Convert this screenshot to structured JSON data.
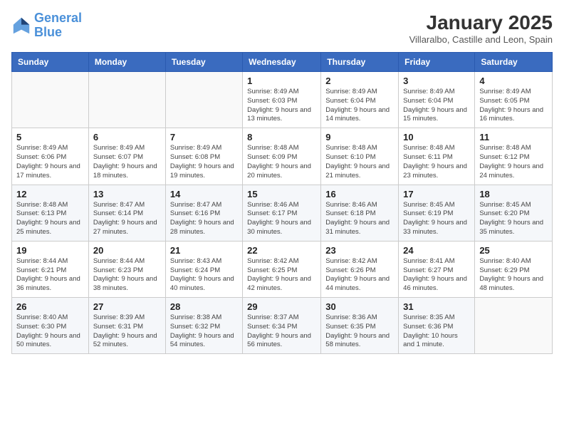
{
  "header": {
    "logo_line1": "General",
    "logo_line2": "Blue",
    "month": "January 2025",
    "location": "Villaralbo, Castille and Leon, Spain"
  },
  "weekdays": [
    "Sunday",
    "Monday",
    "Tuesday",
    "Wednesday",
    "Thursday",
    "Friday",
    "Saturday"
  ],
  "weeks": [
    [
      {
        "day": "",
        "detail": ""
      },
      {
        "day": "",
        "detail": ""
      },
      {
        "day": "",
        "detail": ""
      },
      {
        "day": "1",
        "detail": "Sunrise: 8:49 AM\nSunset: 6:03 PM\nDaylight: 9 hours and 13 minutes."
      },
      {
        "day": "2",
        "detail": "Sunrise: 8:49 AM\nSunset: 6:04 PM\nDaylight: 9 hours and 14 minutes."
      },
      {
        "day": "3",
        "detail": "Sunrise: 8:49 AM\nSunset: 6:04 PM\nDaylight: 9 hours and 15 minutes."
      },
      {
        "day": "4",
        "detail": "Sunrise: 8:49 AM\nSunset: 6:05 PM\nDaylight: 9 hours and 16 minutes."
      }
    ],
    [
      {
        "day": "5",
        "detail": "Sunrise: 8:49 AM\nSunset: 6:06 PM\nDaylight: 9 hours and 17 minutes."
      },
      {
        "day": "6",
        "detail": "Sunrise: 8:49 AM\nSunset: 6:07 PM\nDaylight: 9 hours and 18 minutes."
      },
      {
        "day": "7",
        "detail": "Sunrise: 8:49 AM\nSunset: 6:08 PM\nDaylight: 9 hours and 19 minutes."
      },
      {
        "day": "8",
        "detail": "Sunrise: 8:48 AM\nSunset: 6:09 PM\nDaylight: 9 hours and 20 minutes."
      },
      {
        "day": "9",
        "detail": "Sunrise: 8:48 AM\nSunset: 6:10 PM\nDaylight: 9 hours and 21 minutes."
      },
      {
        "day": "10",
        "detail": "Sunrise: 8:48 AM\nSunset: 6:11 PM\nDaylight: 9 hours and 23 minutes."
      },
      {
        "day": "11",
        "detail": "Sunrise: 8:48 AM\nSunset: 6:12 PM\nDaylight: 9 hours and 24 minutes."
      }
    ],
    [
      {
        "day": "12",
        "detail": "Sunrise: 8:48 AM\nSunset: 6:13 PM\nDaylight: 9 hours and 25 minutes."
      },
      {
        "day": "13",
        "detail": "Sunrise: 8:47 AM\nSunset: 6:14 PM\nDaylight: 9 hours and 27 minutes."
      },
      {
        "day": "14",
        "detail": "Sunrise: 8:47 AM\nSunset: 6:16 PM\nDaylight: 9 hours and 28 minutes."
      },
      {
        "day": "15",
        "detail": "Sunrise: 8:46 AM\nSunset: 6:17 PM\nDaylight: 9 hours and 30 minutes."
      },
      {
        "day": "16",
        "detail": "Sunrise: 8:46 AM\nSunset: 6:18 PM\nDaylight: 9 hours and 31 minutes."
      },
      {
        "day": "17",
        "detail": "Sunrise: 8:45 AM\nSunset: 6:19 PM\nDaylight: 9 hours and 33 minutes."
      },
      {
        "day": "18",
        "detail": "Sunrise: 8:45 AM\nSunset: 6:20 PM\nDaylight: 9 hours and 35 minutes."
      }
    ],
    [
      {
        "day": "19",
        "detail": "Sunrise: 8:44 AM\nSunset: 6:21 PM\nDaylight: 9 hours and 36 minutes."
      },
      {
        "day": "20",
        "detail": "Sunrise: 8:44 AM\nSunset: 6:23 PM\nDaylight: 9 hours and 38 minutes."
      },
      {
        "day": "21",
        "detail": "Sunrise: 8:43 AM\nSunset: 6:24 PM\nDaylight: 9 hours and 40 minutes."
      },
      {
        "day": "22",
        "detail": "Sunrise: 8:42 AM\nSunset: 6:25 PM\nDaylight: 9 hours and 42 minutes."
      },
      {
        "day": "23",
        "detail": "Sunrise: 8:42 AM\nSunset: 6:26 PM\nDaylight: 9 hours and 44 minutes."
      },
      {
        "day": "24",
        "detail": "Sunrise: 8:41 AM\nSunset: 6:27 PM\nDaylight: 9 hours and 46 minutes."
      },
      {
        "day": "25",
        "detail": "Sunrise: 8:40 AM\nSunset: 6:29 PM\nDaylight: 9 hours and 48 minutes."
      }
    ],
    [
      {
        "day": "26",
        "detail": "Sunrise: 8:40 AM\nSunset: 6:30 PM\nDaylight: 9 hours and 50 minutes."
      },
      {
        "day": "27",
        "detail": "Sunrise: 8:39 AM\nSunset: 6:31 PM\nDaylight: 9 hours and 52 minutes."
      },
      {
        "day": "28",
        "detail": "Sunrise: 8:38 AM\nSunset: 6:32 PM\nDaylight: 9 hours and 54 minutes."
      },
      {
        "day": "29",
        "detail": "Sunrise: 8:37 AM\nSunset: 6:34 PM\nDaylight: 9 hours and 56 minutes."
      },
      {
        "day": "30",
        "detail": "Sunrise: 8:36 AM\nSunset: 6:35 PM\nDaylight: 9 hours and 58 minutes."
      },
      {
        "day": "31",
        "detail": "Sunrise: 8:35 AM\nSunset: 6:36 PM\nDaylight: 10 hours and 1 minute."
      },
      {
        "day": "",
        "detail": ""
      }
    ]
  ]
}
